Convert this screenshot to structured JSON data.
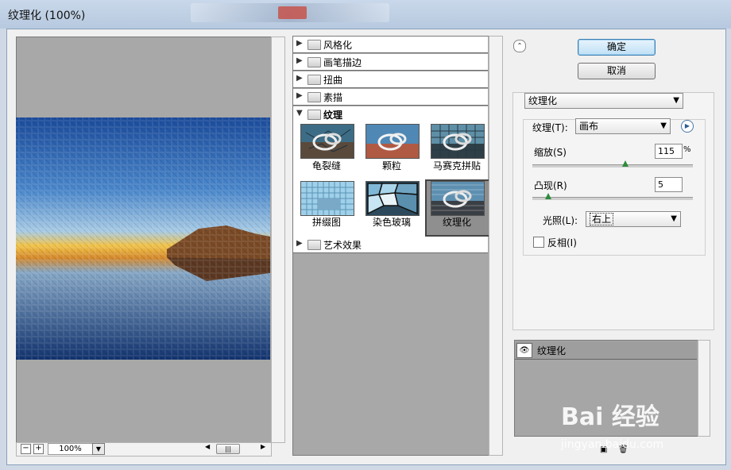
{
  "window": {
    "title": "纹理化 (100%)"
  },
  "preview": {
    "zoom": "100%"
  },
  "filter_categories": [
    {
      "label": "风格化",
      "expanded": false
    },
    {
      "label": "画笔描边",
      "expanded": false
    },
    {
      "label": "扭曲",
      "expanded": false
    },
    {
      "label": "素描",
      "expanded": false
    },
    {
      "label": "纹理",
      "expanded": true
    },
    {
      "label": "艺术效果",
      "expanded": false
    }
  ],
  "texture_filters": [
    {
      "label": "龟裂缝",
      "selected": false
    },
    {
      "label": "颗粒",
      "selected": false
    },
    {
      "label": "马赛克拼贴",
      "selected": false
    },
    {
      "label": "拼缀图",
      "selected": false
    },
    {
      "label": "染色玻璃",
      "selected": false
    },
    {
      "label": "纹理化",
      "selected": true
    }
  ],
  "buttons": {
    "ok": "确定",
    "cancel": "取消"
  },
  "settings": {
    "filter_select": "纹理化",
    "texture_label": "纹理(T):",
    "texture_value": "画布",
    "scaling_label": "缩放(S)",
    "scaling_value": "115",
    "scaling_unit": "%",
    "scaling_level": 0.58,
    "relief_label": "凸现(R)",
    "relief_value": "5",
    "relief_level": 0.1,
    "light_label": "光照(L):",
    "light_value": "右上",
    "invert_label": "反相(I)",
    "invert_checked": false
  },
  "layers": {
    "items": [
      {
        "name": "纹理化",
        "visible": true
      }
    ]
  },
  "watermark": {
    "text": "Bai 经验",
    "url": "jingyan.baidu.com"
  }
}
